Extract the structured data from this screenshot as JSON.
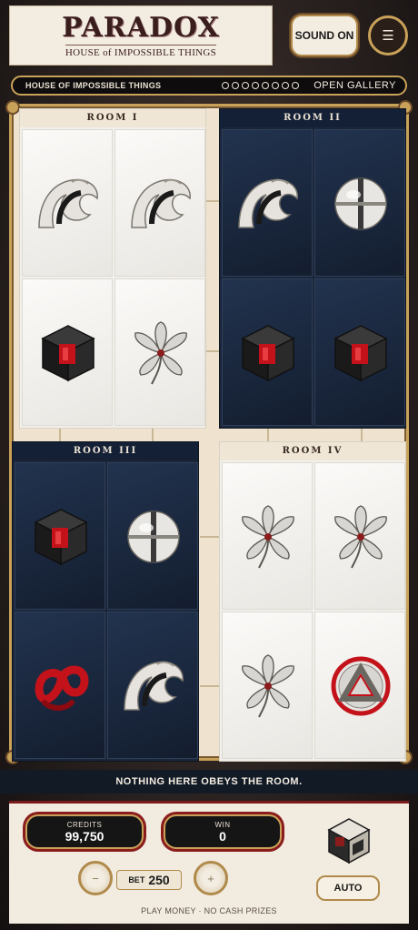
{
  "logo": {
    "title": "PARADOX",
    "subtitle": "HOUSE of IMPOSSIBLE THINGS"
  },
  "header": {
    "sound_label": "SOUND ON",
    "menu_icon": "hamburger-icon"
  },
  "gallery_bar": {
    "title": "HOUSE OF IMPOSSIBLE THINGS",
    "dots": 8,
    "link": "OPEN GALLERY"
  },
  "rooms": [
    {
      "label": "ROOM I",
      "theme": "light",
      "symbols": [
        "wave",
        "wave",
        "cube",
        "lily"
      ]
    },
    {
      "label": "ROOM II",
      "theme": "dark",
      "symbols": [
        "wave",
        "sphere",
        "cube",
        "cube"
      ]
    },
    {
      "label": "ROOM III",
      "theme": "dark",
      "symbols": [
        "cube",
        "sphere",
        "ribbon",
        "wave"
      ]
    },
    {
      "label": "ROOM IV",
      "theme": "light",
      "symbols": [
        "lily",
        "lily",
        "lily",
        "triangle"
      ]
    }
  ],
  "message": "NOTHING HERE OBEYS THE ROOM.",
  "credits": {
    "label": "CREDITS",
    "value": "99,750"
  },
  "win": {
    "label": "WIN",
    "value": "0"
  },
  "bet": {
    "label": "BET",
    "value": "250"
  },
  "buttons": {
    "minus": "−",
    "plus": "+",
    "auto": "AUTO",
    "spin_icon": "spin-cube-icon"
  },
  "footer": "PLAY MONEY · NO CASH PRIZES",
  "colors": {
    "gold": "#c9a25a",
    "crimson": "#8a1c1c",
    "navy": "#1b2638",
    "ivory": "#f2f0ec"
  }
}
